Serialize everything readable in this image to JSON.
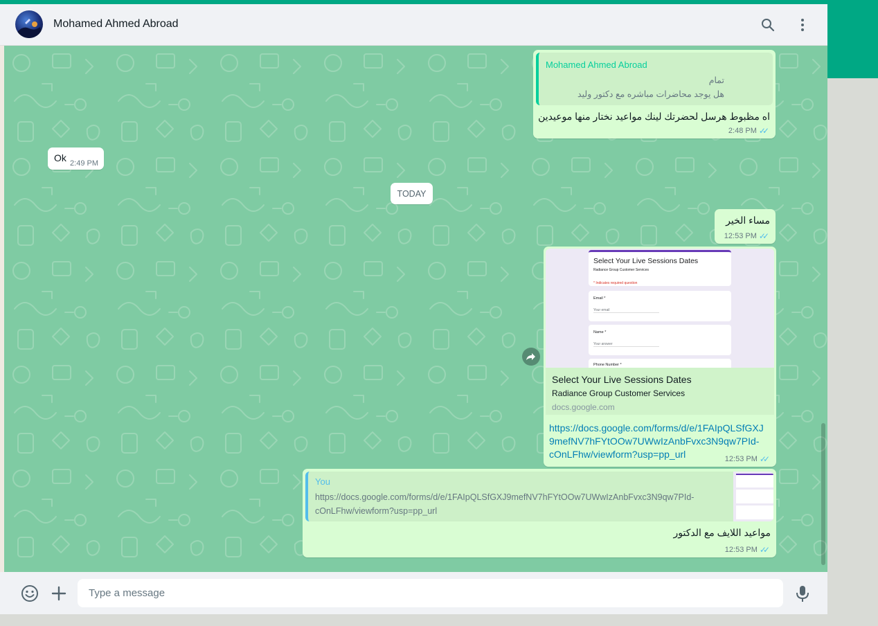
{
  "header": {
    "contact_name": "Mohamed Ahmed Abroad",
    "search_icon": "search-icon",
    "menu_icon": "more-vertical-icon"
  },
  "messages": {
    "m1": {
      "quote_author": "Mohamed Ahmed Abroad",
      "quote_line1": "تمام",
      "quote_line2": "هل يوجد محاضرات مباشره مع دكتور وليد",
      "text": "اه مظبوط هرسل لحضرتك لينك مواعيد نختار منها موعيدين",
      "time": "2:48 PM"
    },
    "m2": {
      "text": "Ok",
      "time": "2:49 PM"
    },
    "date_divider": "TODAY",
    "m3": {
      "text": "مساء الخير",
      "time": "12:53 PM"
    },
    "m4": {
      "preview": {
        "form_title": "Select Your Live Sessions Dates",
        "form_subtitle": "Radiance Group Customer Services",
        "form_required": "* Indicates required question",
        "field1_label": "Email *",
        "field1_placeholder": "Your email",
        "field2_label": "Name *",
        "field2_placeholder": "Your answer",
        "field3_label": "Phone Number *"
      },
      "link_title": "Select Your Live Sessions Dates",
      "link_description": "Radiance Group Customer Services",
      "link_domain": "docs.google.com",
      "url_line1": "https://docs.google.com/forms/d/e/1FAIpQLSfGXJ",
      "url_line2": "9mefNV7hFYtOOw7UWwIzAnbFvxc3N9qw7PId-",
      "url_line3": "cOnLFhw/viewform?usp=pp_url",
      "time": "12:53 PM"
    },
    "m5": {
      "quote_author": "You",
      "quote_line1": "https://docs.google.com/forms/d/e/1FAIpQLSfGXJ9mefNV7hFYtOOw7UWwIzAnbFvxc3N9qw7PId-",
      "quote_line2": "cOnLFhw/viewform?usp=pp_url",
      "text": "مواعيد اللايف مع الدكتور",
      "time": "12:53 PM"
    }
  },
  "composer": {
    "placeholder": "Type a message",
    "emoji_icon": "emoji-icon",
    "attach_icon": "plus-icon",
    "mic_icon": "microphone-icon"
  },
  "colors": {
    "accent": "#00a884",
    "chat_bg": "#7fcba3",
    "outgoing_bubble": "#d9fdd3",
    "incoming_bubble": "#ffffff",
    "link": "#027eb5",
    "read_ticks": "#53bdeb"
  }
}
